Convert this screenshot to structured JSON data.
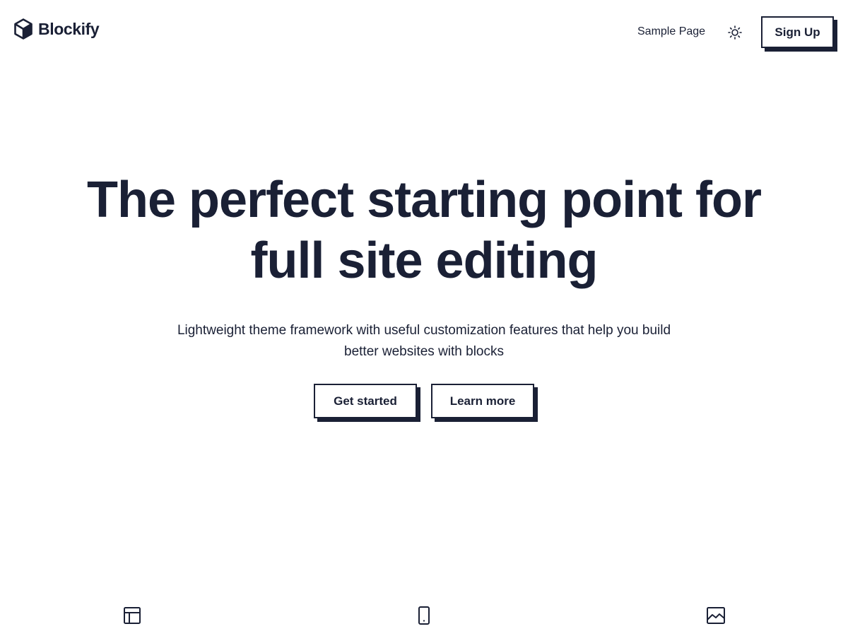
{
  "header": {
    "logo_text": "Blockify",
    "logo_icon": "cube-icon",
    "nav": [
      {
        "label": "Sample Page"
      }
    ],
    "theme_toggle_icon": "sun-icon",
    "signup_label": "Sign Up"
  },
  "hero": {
    "title": "The perfect starting point for full site editing",
    "subtitle": "Lightweight theme framework with useful customization features that help you build better websites with blocks",
    "buttons": {
      "primary": "Get started",
      "secondary": "Learn more"
    }
  },
  "features": {
    "icons": [
      "layout-icon",
      "mobile-icon",
      "image-icon"
    ]
  },
  "colors": {
    "text": "#1a2035",
    "background": "#ffffff",
    "shadow": "#1a2035"
  }
}
